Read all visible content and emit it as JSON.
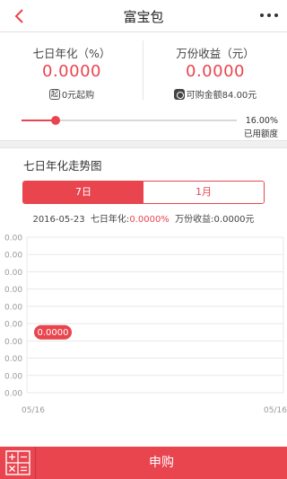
{
  "header": {
    "title": "富宝包",
    "back_icon": "chevron-left-icon",
    "more_icon": "more-dots-icon"
  },
  "stats": {
    "annualized_label": "七日年化（%）",
    "annualized_value": "0.0000",
    "min_purchase_badge": "起",
    "min_purchase_text": "0元起购",
    "income_label": "万份收益（元）",
    "income_value": "0.0000",
    "available_text": "可购金额84.00元"
  },
  "quota": {
    "used_percent": 16,
    "percent_text": "16.00%",
    "label": "已用额度"
  },
  "trend": {
    "title": "七日年化走势图",
    "tabs": [
      {
        "label": "7日",
        "active": true
      },
      {
        "label": "1月",
        "active": false
      }
    ],
    "info_date": "2016-05-23",
    "info_annualized_label": "七日年化:",
    "info_annualized_value": "0.0000%",
    "info_income_label": "万份收益:",
    "info_income_value": "0.0000元"
  },
  "chart_data": {
    "type": "line",
    "y_tick_labels": [
      "0.00",
      "0.00",
      "0.00",
      "0.00",
      "0.00",
      "0.00",
      "0.00",
      "0.00",
      "0.00",
      "0.00"
    ],
    "x_tick_labels": [
      "05/16",
      "05/16"
    ],
    "points": [
      {
        "x": "05/16",
        "y": 0.0
      }
    ],
    "tooltip": "0.0000",
    "grid": true,
    "accent_color": "#e8454f"
  },
  "bottom": {
    "calc_icon": "calculator-icon",
    "buy_label": "申购"
  },
  "colors": {
    "accent": "#e8454f",
    "divider": "#e5e5e5"
  }
}
